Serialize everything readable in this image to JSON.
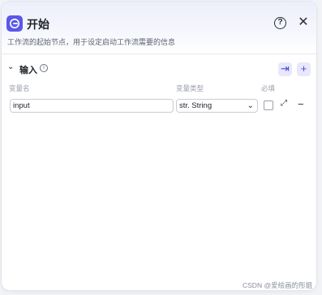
{
  "node": {
    "title": "开始",
    "description": "工作流的起始节点，用于设定启动工作流需要的信息",
    "help_icon": "?",
    "close_icon": "✕"
  },
  "input_section": {
    "title": "输入",
    "info_icon": "i",
    "chevron": "⌄",
    "import_icon": "⇥",
    "add_icon": "+",
    "columns": {
      "name": "变量名",
      "type": "变量类型",
      "required": "必填"
    },
    "rows": [
      {
        "name": "input",
        "type": "str. String",
        "required": false
      }
    ]
  },
  "watermark": "CSDN @爱绘画的彤姐",
  "colors": {
    "accent": "#5b57e8"
  }
}
